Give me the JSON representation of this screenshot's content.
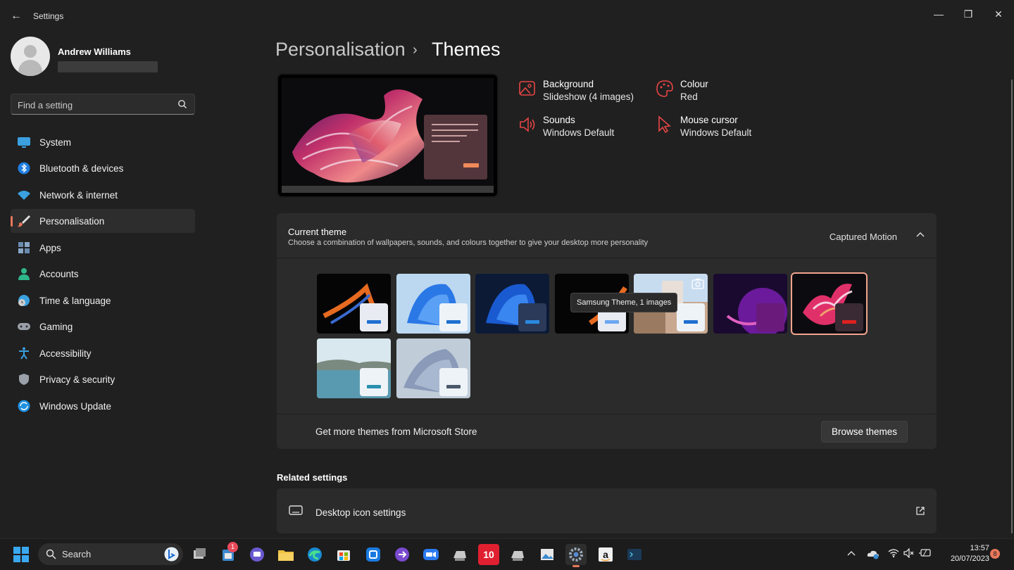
{
  "window": {
    "title": "Settings",
    "minimize": "—",
    "maximize": "❐",
    "close": "✕",
    "back": "←"
  },
  "user": {
    "name": "Andrew Williams"
  },
  "search": {
    "placeholder": "Find a setting"
  },
  "nav": [
    {
      "label": "System",
      "icon": "monitor-icon"
    },
    {
      "label": "Bluetooth & devices",
      "icon": "bluetooth-icon"
    },
    {
      "label": "Network & internet",
      "icon": "wifi-icon"
    },
    {
      "label": "Personalisation",
      "icon": "brush-icon",
      "active": true
    },
    {
      "label": "Apps",
      "icon": "apps-icon"
    },
    {
      "label": "Accounts",
      "icon": "person-icon"
    },
    {
      "label": "Time & language",
      "icon": "globe-clock-icon"
    },
    {
      "label": "Gaming",
      "icon": "gamepad-icon"
    },
    {
      "label": "Accessibility",
      "icon": "accessibility-icon"
    },
    {
      "label": "Privacy & security",
      "icon": "shield-icon"
    },
    {
      "label": "Windows Update",
      "icon": "update-icon"
    }
  ],
  "breadcrumb": {
    "parent": "Personalisation",
    "separator": "›",
    "current": "Themes"
  },
  "properties": {
    "background": {
      "label": "Background",
      "value": "Slideshow (4 images)"
    },
    "colour": {
      "label": "Colour",
      "value": "Red"
    },
    "sounds": {
      "label": "Sounds",
      "value": "Windows Default"
    },
    "cursor": {
      "label": "Mouse cursor",
      "value": "Windows Default"
    }
  },
  "current_theme": {
    "title": "Current theme",
    "subtitle": "Choose a combination of wallpapers, sounds, and colours together to give your desktop more personality",
    "value": "Captured Motion",
    "chevron": "^",
    "tooltip": "Samsung Theme, 1 images",
    "store_text": "Get more themes from Microsoft Store",
    "browse_button": "Browse themes"
  },
  "related": {
    "title": "Related settings",
    "items": [
      {
        "label": "Desktop icon settings"
      }
    ]
  },
  "taskbar": {
    "search_label": "Search",
    "time": "13:57",
    "date": "20/07/2023",
    "notification_count": "8",
    "store_badge": "1",
    "app_tile_text": "10"
  },
  "colors": {
    "accent": "#e8785a",
    "background": "#202020",
    "card": "#2b2b2b"
  }
}
